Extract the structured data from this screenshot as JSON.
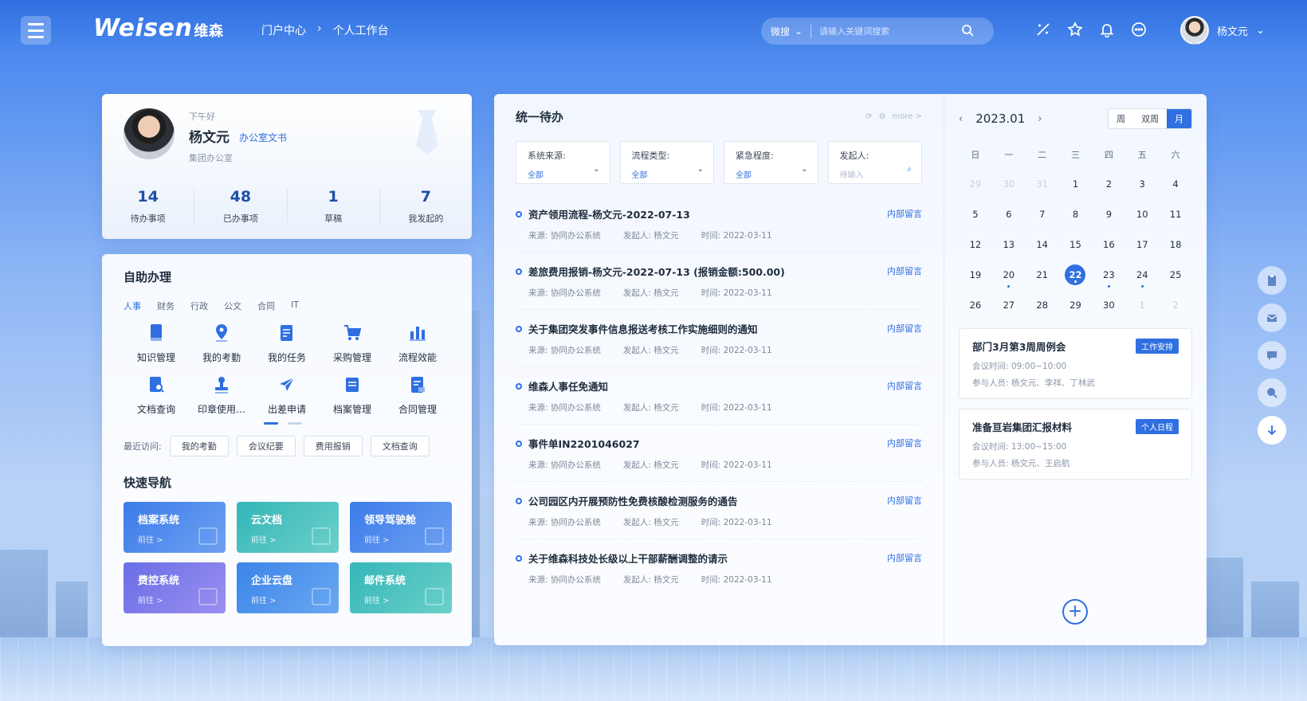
{
  "header": {
    "logo_text": "Weisen",
    "logo_cn": "维森",
    "breadcrumb": [
      "门户中心",
      "›",
      "个人工作台"
    ],
    "search_scope": "微搜",
    "search_placeholder": "请输入关键词搜索",
    "icons": [
      "magic-wand-icon",
      "star-icon",
      "bell-icon",
      "more-icon"
    ],
    "user_name": "杨文元"
  },
  "profile": {
    "greeting": "下午好",
    "name": "杨文元",
    "role": "办公室文书",
    "dept": "集团办公室",
    "stats": [
      {
        "value": "14",
        "label": "待办事项"
      },
      {
        "value": "48",
        "label": "已办事项"
      },
      {
        "value": "1",
        "label": "草稿"
      },
      {
        "value": "7",
        "label": "我发起的"
      }
    ]
  },
  "self_service": {
    "title": "自助办理",
    "tabs": [
      "人事",
      "财务",
      "行政",
      "公文",
      "合同",
      "IT"
    ],
    "active_tab": "人事",
    "items": [
      {
        "label": "知识管理",
        "icon": "book-icon"
      },
      {
        "label": "我的考勤",
        "icon": "location-icon"
      },
      {
        "label": "我的任务",
        "icon": "task-icon"
      },
      {
        "label": "采购管理",
        "icon": "cart-icon"
      },
      {
        "label": "流程效能",
        "icon": "bar-chart-icon"
      },
      {
        "label": "文档查询",
        "icon": "doc-search-icon"
      },
      {
        "label": "印章使用…",
        "icon": "stamp-icon"
      },
      {
        "label": "出差申请",
        "icon": "plane-icon"
      },
      {
        "label": "档案管理",
        "icon": "archive-icon"
      },
      {
        "label": "合同管理",
        "icon": "contract-icon"
      }
    ],
    "recent_label": "最近访问:",
    "recent": [
      "我的考勤",
      "会议纪要",
      "费用报销",
      "文档查询"
    ]
  },
  "quick_nav": {
    "title": "快速导航",
    "go": "前往 >",
    "tiles": [
      "档案系统",
      "云文档",
      "领导驾驶舱",
      "费控系统",
      "企业云盘",
      "邮件系统"
    ]
  },
  "todo": {
    "title": "统一待办",
    "more": "more >",
    "filters": [
      {
        "label": "系统来源:",
        "value": "全部",
        "placeholder": false
      },
      {
        "label": "流程类型:",
        "value": "全部",
        "placeholder": false
      },
      {
        "label": "紧急程度:",
        "value": "全部",
        "placeholder": false
      },
      {
        "label": "发起人:",
        "value": "待输入",
        "placeholder": true
      }
    ],
    "message_label": "内部留言",
    "items": [
      {
        "title": "资产领用流程-杨文元-2022-07-13",
        "source": "来源: 协同办公系统",
        "initiator": "发起人: 杨文元",
        "time": "时间: 2022-03-11"
      },
      {
        "title": "差旅费用报销-杨文元-2022-07-13 (报销金额:500.00)",
        "source": "来源: 协同办公系统",
        "initiator": "发起人: 杨文元",
        "time": "时间: 2022-03-11"
      },
      {
        "title": "关于集团突发事件信息报送考核工作实施细则的通知",
        "source": "来源: 协同办公系统",
        "initiator": "发起人: 杨文元",
        "time": "时间: 2022-03-11"
      },
      {
        "title": "维森人事任免通知",
        "source": "来源: 协同办公系统",
        "initiator": "发起人: 杨文元",
        "time": "时间: 2022-03-11"
      },
      {
        "title": "事件单IN2201046027",
        "source": "来源: 协同办公系统",
        "initiator": "发起人: 杨文元",
        "time": "时间: 2022-03-11"
      },
      {
        "title": "公司园区内开展预防性免费核酸检测服务的通告",
        "source": "来源: 协同办公系统",
        "initiator": "发起人: 杨文元",
        "time": "时间: 2022-03-11"
      },
      {
        "title": "关于维森科技处长级以上干部薪酬调整的请示",
        "source": "来源: 协同办公系统",
        "initiator": "发起人: 杨文元",
        "time": "时间: 2022-03-11"
      }
    ]
  },
  "calendar": {
    "month": "2023.01",
    "views": [
      "周",
      "双周",
      "月"
    ],
    "active_view": "月",
    "weekdays": [
      "日",
      "一",
      "二",
      "三",
      "四",
      "五",
      "六"
    ],
    "days": [
      {
        "d": "29",
        "mute": true
      },
      {
        "d": "30",
        "mute": true
      },
      {
        "d": "31",
        "mute": true
      },
      {
        "d": "1"
      },
      {
        "d": "2"
      },
      {
        "d": "3"
      },
      {
        "d": "4"
      },
      {
        "d": "5"
      },
      {
        "d": "6"
      },
      {
        "d": "7"
      },
      {
        "d": "8"
      },
      {
        "d": "9"
      },
      {
        "d": "10"
      },
      {
        "d": "11"
      },
      {
        "d": "12"
      },
      {
        "d": "13"
      },
      {
        "d": "14"
      },
      {
        "d": "15"
      },
      {
        "d": "16"
      },
      {
        "d": "17"
      },
      {
        "d": "18"
      },
      {
        "d": "19"
      },
      {
        "d": "20",
        "mark": true
      },
      {
        "d": "21"
      },
      {
        "d": "22",
        "today": true,
        "mark": true
      },
      {
        "d": "23",
        "mark": true
      },
      {
        "d": "24",
        "mark": true
      },
      {
        "d": "25"
      },
      {
        "d": "26"
      },
      {
        "d": "27"
      },
      {
        "d": "28"
      },
      {
        "d": "29"
      },
      {
        "d": "30"
      },
      {
        "d": "1",
        "mute": true
      },
      {
        "d": "2",
        "mute": true
      }
    ],
    "events": [
      {
        "title": "部门3月第3周周例会",
        "tag": "工作安排",
        "time": "会议时间: 09:00~10:00",
        "people": "参与人员: 杨文元、李祥、丁林武"
      },
      {
        "title": "准备亘岩集团汇报材料",
        "tag": "个人日程",
        "time": "会议时间: 13:00~15:00",
        "people": "参与人员: 杨文元、王启航"
      }
    ]
  },
  "dock": [
    "clipboard-icon",
    "mail-icon",
    "chat-icon",
    "search-doc-icon",
    "arrow-down-icon"
  ],
  "colors": {
    "accent": "#2f6fe0"
  }
}
